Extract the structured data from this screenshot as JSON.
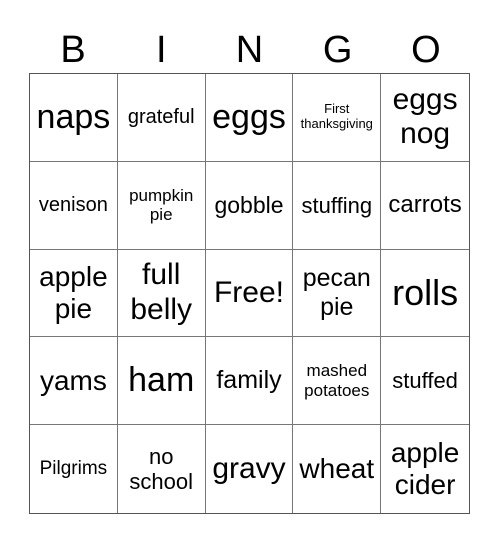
{
  "header": {
    "letters": [
      "B",
      "I",
      "N",
      "G",
      "O"
    ]
  },
  "cells": [
    {
      "text": "naps",
      "size": "xl"
    },
    {
      "text": "grateful",
      "size": "s"
    },
    {
      "text": "eggs",
      "size": "xl"
    },
    {
      "text": "First thanksgiving",
      "size": "xxs"
    },
    {
      "text": "eggs nog",
      "size": "l"
    },
    {
      "text": "venison",
      "size": "s"
    },
    {
      "text": "pumpkin pie",
      "size": "xs"
    },
    {
      "text": "gobble",
      "size": "m"
    },
    {
      "text": "stuffing",
      "size": "m"
    },
    {
      "text": "carrots",
      "size": "m"
    },
    {
      "text": "apple pie",
      "size": "l"
    },
    {
      "text": "full belly",
      "size": "l"
    },
    {
      "text": "Free!",
      "size": "l"
    },
    {
      "text": "pecan pie",
      "size": "m"
    },
    {
      "text": "rolls",
      "size": "xl"
    },
    {
      "text": "yams",
      "size": "l"
    },
    {
      "text": "ham",
      "size": "xl"
    },
    {
      "text": "family",
      "size": "m"
    },
    {
      "text": "mashed potatoes",
      "size": "xs"
    },
    {
      "text": "stuffed",
      "size": "m"
    },
    {
      "text": "Pilgrims",
      "size": "s"
    },
    {
      "text": "no school",
      "size": "m"
    },
    {
      "text": "gravy",
      "size": "l"
    },
    {
      "text": "wheat",
      "size": "l"
    },
    {
      "text": "apple cider",
      "size": "l"
    }
  ]
}
